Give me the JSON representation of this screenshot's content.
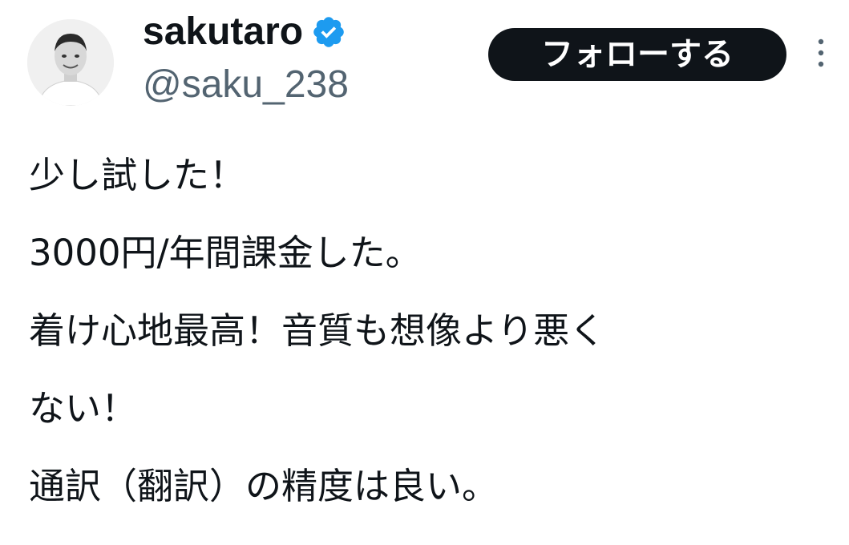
{
  "author": {
    "display_name": "sakutaro",
    "handle": "@saku_238",
    "verified": true,
    "verified_color": "#1d9bf0",
    "avatar_icon": "profile-photo"
  },
  "actions": {
    "follow_label": "フォローする",
    "more_icon": "vertical-ellipsis-icon"
  },
  "tweet": {
    "lines": [
      "少し試した！",
      "3000円/年間課金した。",
      "着け心地最高！音質も想像より悪く",
      "ない！",
      "通訳（翻訳）の精度は良い。"
    ]
  },
  "colors": {
    "text": "#0f1419",
    "secondary": "#536471",
    "button_bg": "#0f1419",
    "button_text": "#ffffff"
  }
}
